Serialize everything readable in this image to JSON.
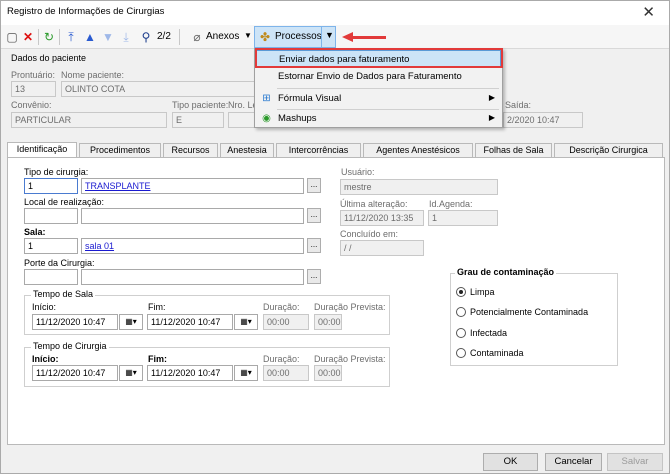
{
  "window": {
    "title": "Registro de Informações de Cirurgias",
    "close_glyph": "✕"
  },
  "toolbar": {
    "record_position": "2/2",
    "anexos_label": "Anexos",
    "processos_label": "Processos"
  },
  "processos_menu": {
    "items": [
      {
        "label": "Enviar dados para faturamento",
        "highlighted": true
      },
      {
        "label": "Estornar Envio de Dados para Faturamento",
        "highlighted": false
      },
      {
        "label": "Fórmula Visual",
        "has_submenu": true,
        "icon": "formula-visual-icon"
      },
      {
        "label": "Mashups",
        "has_submenu": true,
        "icon": "mashups-icon"
      }
    ]
  },
  "patient": {
    "section_title": "Dados do paciente",
    "prontuario_label": "Prontuário:",
    "prontuario_value": "13",
    "nome_label": "Nome paciente:",
    "nome_value": "OLINTO COTA",
    "convenio_label": "Convênio:",
    "convenio_value": "PARTICULAR",
    "tipo_paciente_label": "Tipo paciente:",
    "tipo_paciente_value": "E",
    "nro_label": "Nro. Le",
    "saida_label": "Saída:",
    "saida_value": "2/2020 10:47"
  },
  "tabs": [
    "Identificação",
    "Procedimentos",
    "Recursos",
    "Anestesia",
    "Intercorrências",
    "Agentes Anestésicos",
    "Folhas de Sala",
    "Descrição Cirurgica"
  ],
  "identificacao": {
    "tipo_cirurgia_label": "Tipo de cirurgia:",
    "tipo_cirurgia_code": "1",
    "tipo_cirurgia_name": "TRANSPLANTE",
    "local_label": "Local de realização:",
    "local_code": "",
    "local_name": "",
    "sala_label": "Sala:",
    "sala_code": "1",
    "sala_name": "sala 01",
    "porte_label": "Porte da Cirurgia:",
    "porte_code": "",
    "porte_name": "",
    "usuario_label": "Usuário:",
    "usuario_value": "mestre",
    "ultima_alteracao_label": "Última alteração:",
    "ultima_alteracao_value": "11/12/2020 13:35",
    "id_agenda_label": "Id.Agenda:",
    "id_agenda_value": "1",
    "concluido_label": "Concluído em:",
    "concluido_value": " / /"
  },
  "tempo_sala": {
    "title": "Tempo de Sala",
    "inicio_label": "Início:",
    "inicio_value": "11/12/2020 10:47",
    "fim_label": "Fim:",
    "fim_value": "11/12/2020 10:47",
    "duracao_label": "Duração:",
    "duracao_value": "00:00",
    "duracao_prevista_label": "Duração Prevista:",
    "duracao_prevista_value": "00:00"
  },
  "tempo_cirurgia": {
    "title": "Tempo de Cirurgia",
    "inicio_label": "Início:",
    "inicio_value": "11/12/2020 10:47",
    "fim_label": "Fim:",
    "fim_value": "11/12/2020 10:47",
    "duracao_label": "Duração:",
    "duracao_value": "00:00",
    "duracao_prevista_label": "Duração Prevista:",
    "duracao_prevista_value": "00:00"
  },
  "contaminacao": {
    "title": "Grau de contaminação",
    "options": [
      "Limpa",
      "Potencialmente Contaminada",
      "Infectada",
      "Contaminada"
    ],
    "selected": "Limpa"
  },
  "footer": {
    "ok_label": "OK",
    "cancelar_label": "Cancelar",
    "salvar_label": "Salvar"
  },
  "ellipsis_glyph": "...",
  "calendar_glyph": "▦▾",
  "submenu_glyph": "▶",
  "colors": {
    "highlight_border": "#e23a3a",
    "menu_highlight": "#cce4f7",
    "link": "#1a1ad0"
  }
}
